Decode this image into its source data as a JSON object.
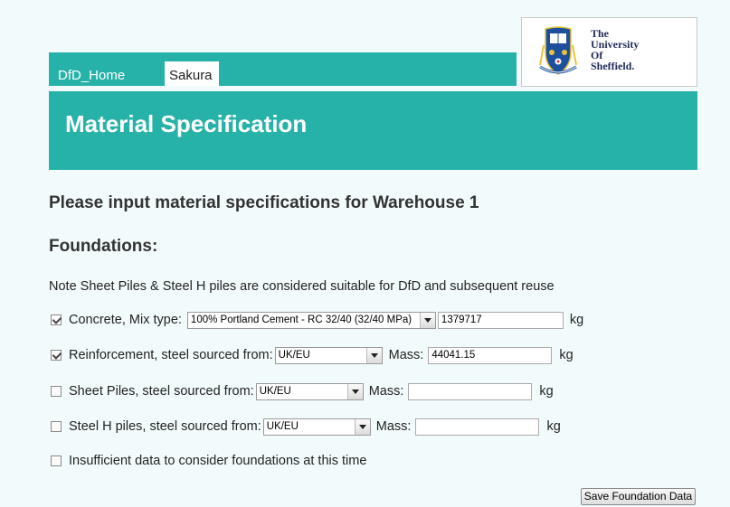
{
  "nav": {
    "home_label": "DfD_Home",
    "active_tab_label": "Sakura"
  },
  "logo": {
    "line1": "The",
    "line2": "University",
    "line3": "Of",
    "line4": "Sheffield.",
    "icon": "university-crest-icon",
    "colors": {
      "blue": "#1e4f9c",
      "gold": "#e8c33a",
      "red": "#c8332f"
    }
  },
  "header": {
    "title": "Material Specification",
    "color": "#26b2a8"
  },
  "form": {
    "heading": "Please input material specifications for Warehouse 1",
    "section_title": "Foundations:",
    "note": "Note Sheet Piles & Steel H piles are considered suitable for DfD and subsequent reuse",
    "concrete": {
      "checked": true,
      "label": "Concrete, Mix type:",
      "mix_selected": "100% Portland Cement - RC 32/40 (32/40 MPa)",
      "value": "1379717",
      "unit": "kg"
    },
    "reinforcement": {
      "checked": true,
      "label": "Reinforcement, steel sourced from:",
      "source_selected": "UK/EU",
      "mass_label": "Mass:",
      "value": "44041.15",
      "unit": "kg"
    },
    "sheet_piles": {
      "checked": false,
      "label": "Sheet Piles, steel sourced from:",
      "source_selected": "UK/EU",
      "mass_label": "Mass:",
      "value": "",
      "unit": "kg"
    },
    "steel_h_piles": {
      "checked": false,
      "label": "Steel H piles, steel sourced from:",
      "source_selected": "UK/EU",
      "mass_label": "Mass:",
      "value": "",
      "unit": "kg"
    },
    "insufficient": {
      "checked": false,
      "label": "Insufficient data to consider foundations at this time"
    },
    "save_label": "Save Foundation Data"
  }
}
